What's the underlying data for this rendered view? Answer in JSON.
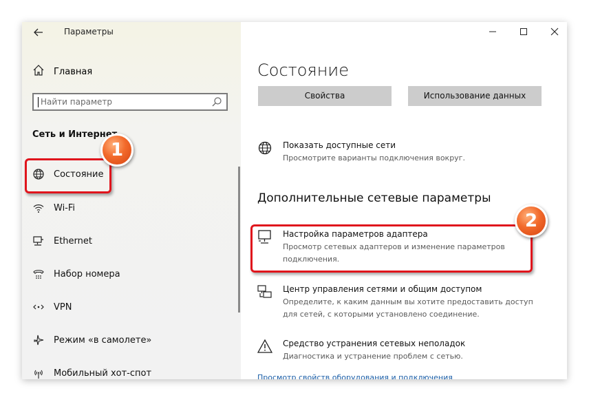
{
  "window": {
    "title": "Параметры",
    "controls": {
      "minimize": "minimize-icon",
      "maximize": "maximize-icon",
      "close": "close-icon"
    }
  },
  "sidebar": {
    "home_label": "Главная",
    "search_placeholder": "Найти параметр",
    "section_title": "Сеть и Интернет",
    "items": [
      {
        "label": "Состояние",
        "icon": "globe-icon"
      },
      {
        "label": "Wi-Fi",
        "icon": "wifi-icon"
      },
      {
        "label": "Ethernet",
        "icon": "ethernet-icon"
      },
      {
        "label": "Набор номера",
        "icon": "dial-up-icon"
      },
      {
        "label": "VPN",
        "icon": "vpn-icon"
      },
      {
        "label": "Режим «в самолете»",
        "icon": "airplane-icon"
      },
      {
        "label": "Мобильный хот-спот",
        "icon": "hotspot-icon"
      }
    ]
  },
  "main": {
    "heading": "Состояние",
    "buttons": {
      "properties": "Свойства",
      "data_usage": "Использование данных"
    },
    "show_networks": {
      "title": "Показать доступные сети",
      "desc": "Просмотрите варианты подключения вокруг."
    },
    "advanced_heading": "Дополнительные сетевые параметры",
    "adapter": {
      "title": "Настройка параметров адаптера",
      "desc": "Просмотр сетевых адаптеров и изменение параметров подключения."
    },
    "sharing_center": {
      "title": "Центр управления сетями и общим доступом",
      "desc": "Определите, к каким данным вы хотите предоставить доступ для сетей, с которыми установлено соединение."
    },
    "troubleshoot": {
      "title": "Средство устранения сетевых неполадок",
      "desc": "Диагностика и устранение проблем с сетью."
    },
    "more_link": "Просмотр свойств оборудования и подключения"
  },
  "annotations": {
    "badge_1": "1",
    "badge_2": "2",
    "highlight_color": "#e0141c",
    "badge_color": "#f26a2b"
  }
}
